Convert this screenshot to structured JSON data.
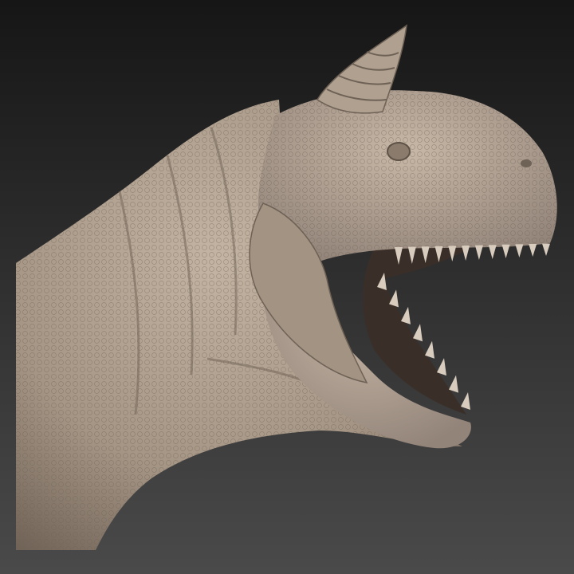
{
  "colors": {
    "background_top": "#161616",
    "background_bottom": "#4a4a4a",
    "skin": "#a59585",
    "skin_light": "#c4b4a3",
    "skin_shadow": "#5e5247",
    "mouth": "#3a2f28",
    "teeth": "#d8ccbe"
  },
  "upper_teeth_count": 12,
  "lower_teeth_count": 8
}
